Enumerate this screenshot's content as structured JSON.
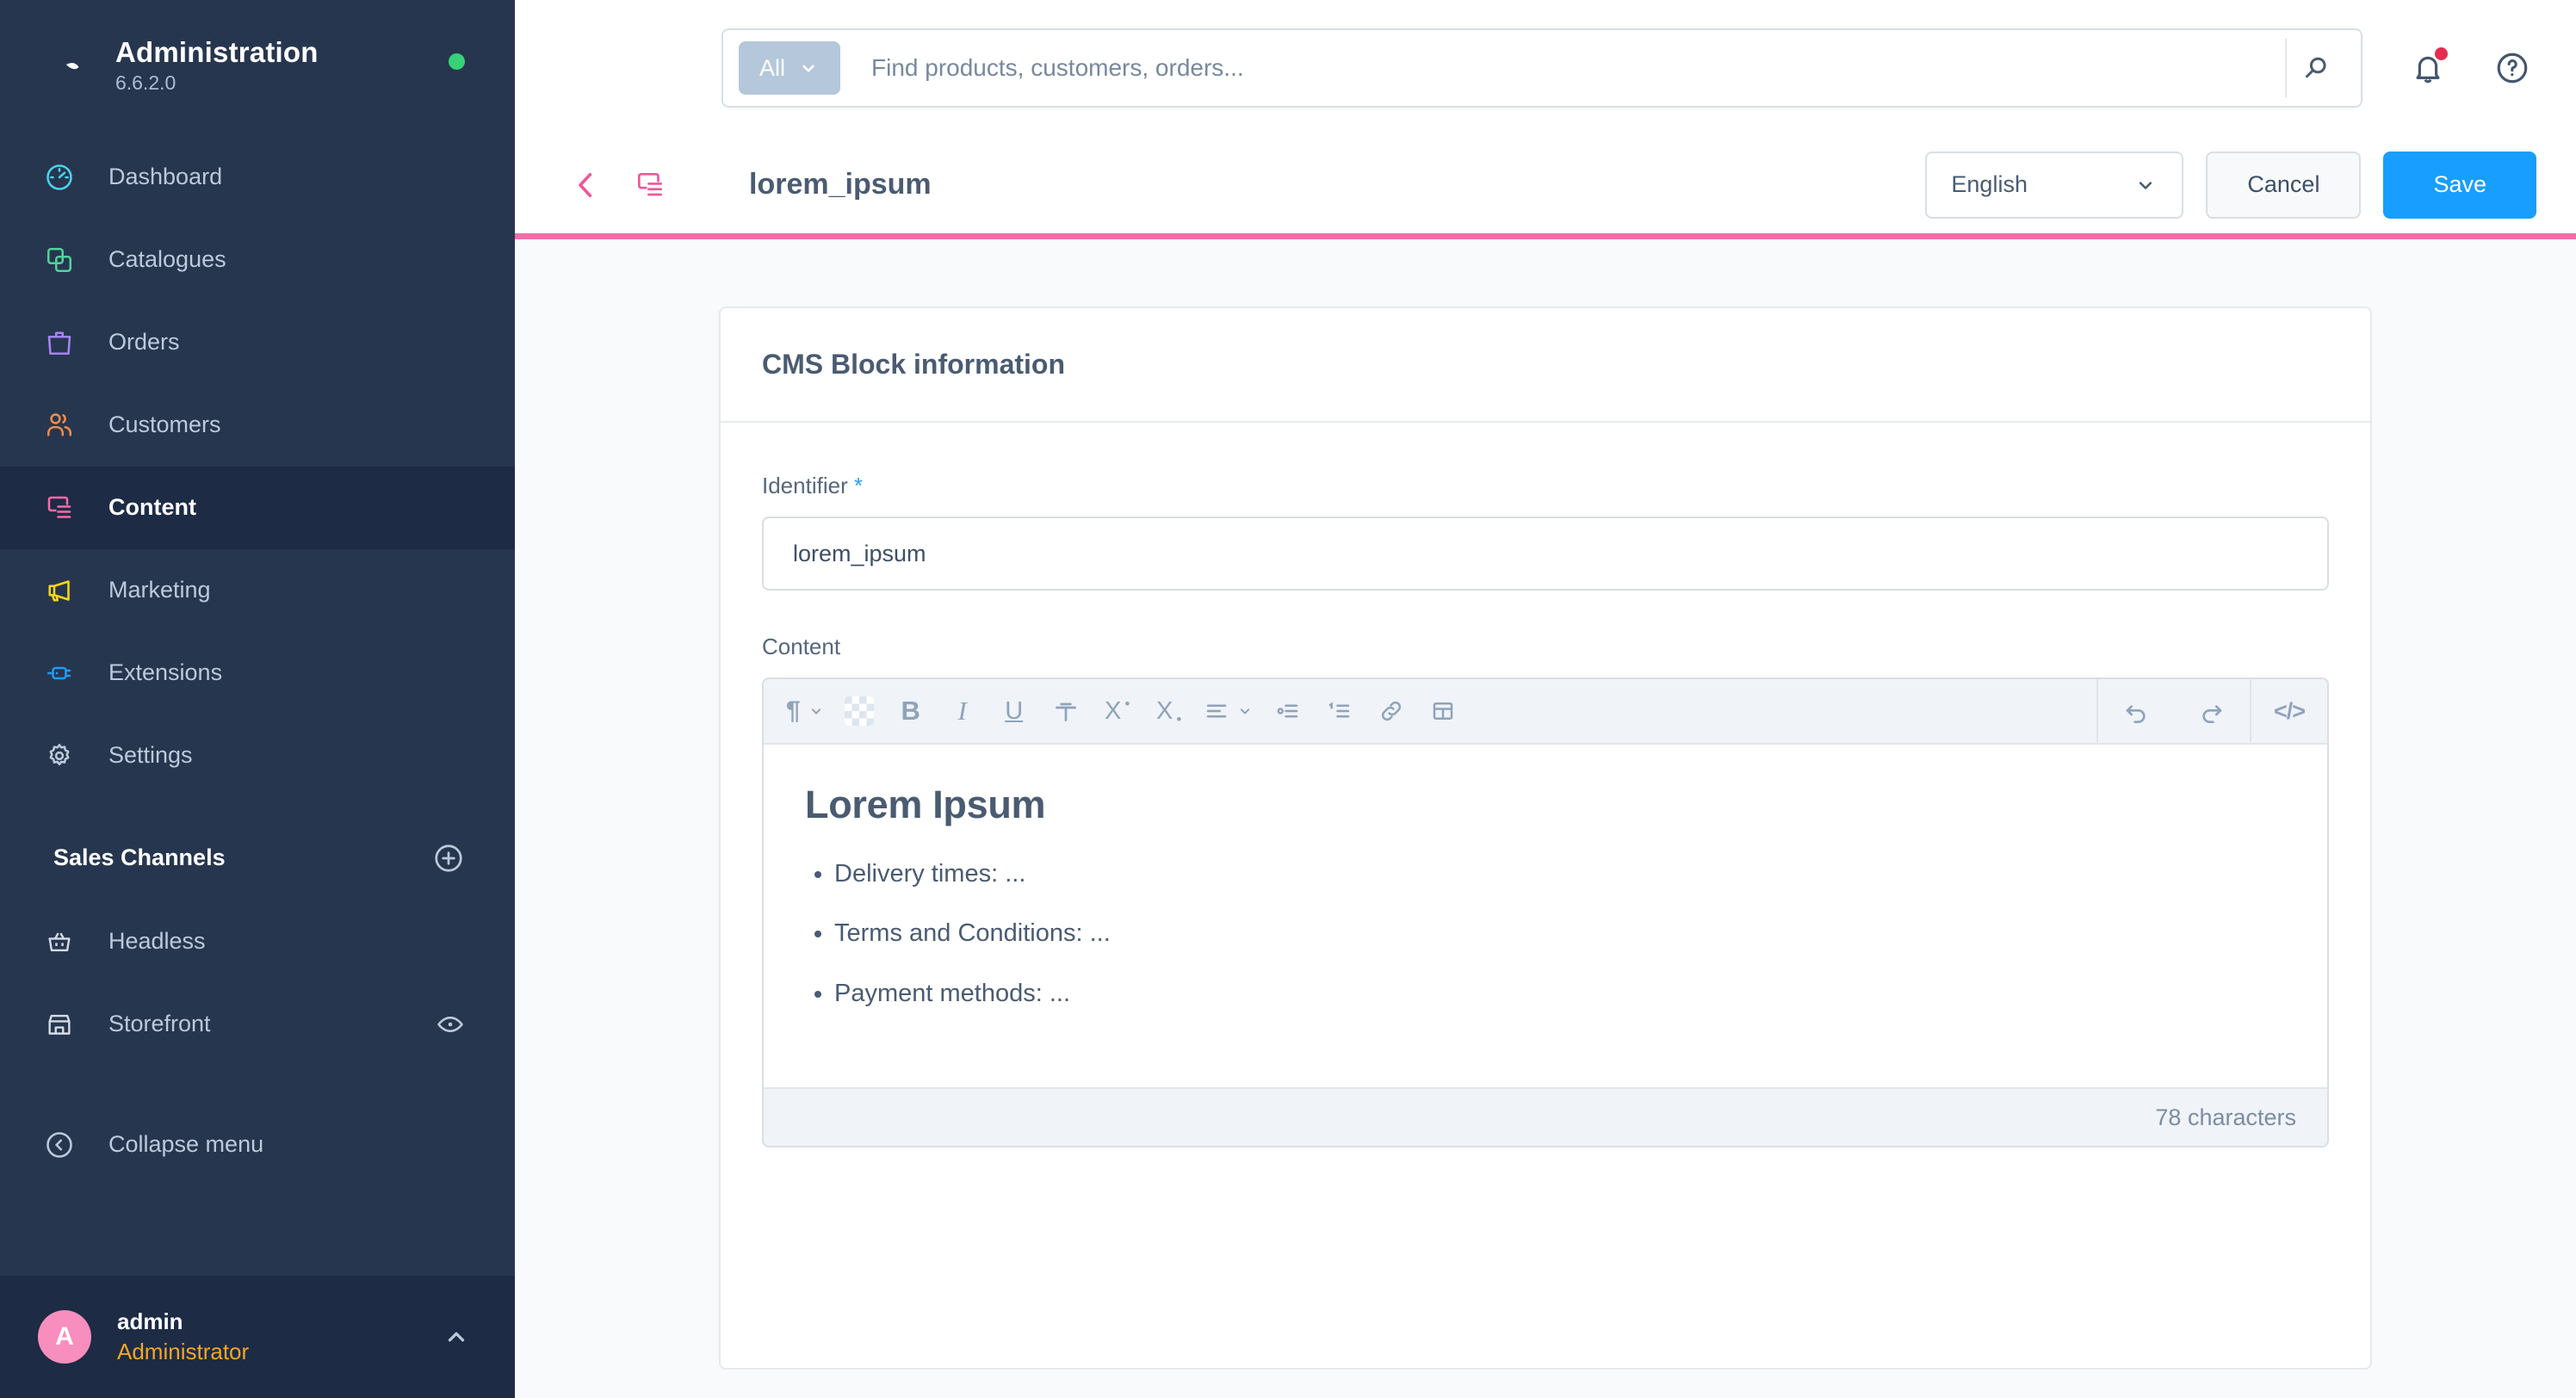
{
  "sidebar": {
    "brand": {
      "title": "Administration",
      "version": "6.6.2.0",
      "status_color": "#37d275"
    },
    "items": [
      {
        "label": "Dashboard",
        "icon": "gauge-icon",
        "color": "#4dd2e8",
        "active": false
      },
      {
        "label": "Catalogues",
        "icon": "copy-icon",
        "color": "#4fd39a",
        "active": false
      },
      {
        "label": "Orders",
        "icon": "bag-icon",
        "color": "#a285f4",
        "active": false
      },
      {
        "label": "Customers",
        "icon": "users-icon",
        "color": "#f08b4a",
        "active": false
      },
      {
        "label": "Content",
        "icon": "content-icon",
        "color": "#f76ba8",
        "active": true
      },
      {
        "label": "Marketing",
        "icon": "megaphone-icon",
        "color": "#f5d616",
        "active": false
      },
      {
        "label": "Extensions",
        "icon": "plug-icon",
        "color": "#1f9bf5",
        "active": false
      },
      {
        "label": "Settings",
        "icon": "gear-icon",
        "color": "#bcc9db",
        "active": false
      }
    ],
    "sales_channels": {
      "title": "Sales Channels",
      "add_label": "+",
      "channels": [
        {
          "label": "Headless",
          "icon": "basket-icon"
        },
        {
          "label": "Storefront",
          "icon": "shop-icon",
          "action_icon": "eye-icon"
        }
      ]
    },
    "collapse_label": "Collapse menu",
    "user": {
      "initial": "A",
      "name": "admin",
      "role": "Administrator",
      "avatar_color": "#f88ebd"
    }
  },
  "topbar": {
    "search_scope": "All",
    "search_value": "",
    "search_placeholder": "Find products, customers, orders...",
    "notifications_icon": "bell-icon",
    "help_icon": "help-circle-icon"
  },
  "page_header": {
    "title": "lorem_ipsum",
    "back_icon": "chevron-left-icon",
    "type_icon": "content-icon",
    "language": "English",
    "cancel_label": "Cancel",
    "save_label": "Save",
    "accent_color": "#f76ba8",
    "primary_color": "#189eff"
  },
  "card": {
    "title": "CMS Block information",
    "identifier": {
      "label": "Identifier",
      "required_marker": "*",
      "value": "lorem_ipsum",
      "placeholder": ""
    },
    "content": {
      "label": "Content",
      "toolbar": [
        {
          "name": "paragraph-format-dropdown",
          "glyph": "¶",
          "caret": true
        },
        {
          "name": "text-color-swatch",
          "glyph": "",
          "caret": false
        },
        {
          "name": "bold-button",
          "glyph": "B",
          "caret": false
        },
        {
          "name": "italic-button",
          "glyph": "I",
          "caret": false
        },
        {
          "name": "underline-button",
          "glyph": "U",
          "caret": false
        },
        {
          "name": "strikethrough-button",
          "glyph": "S",
          "caret": false
        },
        {
          "name": "superscript-button",
          "glyph": "X",
          "caret": false
        },
        {
          "name": "subscript-button",
          "glyph": "X",
          "caret": false
        },
        {
          "name": "align-dropdown",
          "glyph": "≡",
          "caret": true
        },
        {
          "name": "bulleted-list-button",
          "glyph": "",
          "caret": false
        },
        {
          "name": "numbered-list-button",
          "glyph": "1",
          "caret": false
        },
        {
          "name": "insert-link-button",
          "glyph": "",
          "caret": false
        },
        {
          "name": "insert-table-button",
          "glyph": "",
          "caret": false
        }
      ],
      "toolbar_right": [
        {
          "name": "undo-button",
          "glyph": ""
        },
        {
          "name": "redo-button",
          "glyph": ""
        },
        {
          "name": "source-code-button",
          "glyph": "</>"
        }
      ],
      "heading": "Lorem Ipsum",
      "bullets": [
        "Delivery times: ...",
        "Terms and Conditions: ...",
        "Payment methods: ..."
      ],
      "character_count": "78 characters"
    }
  }
}
